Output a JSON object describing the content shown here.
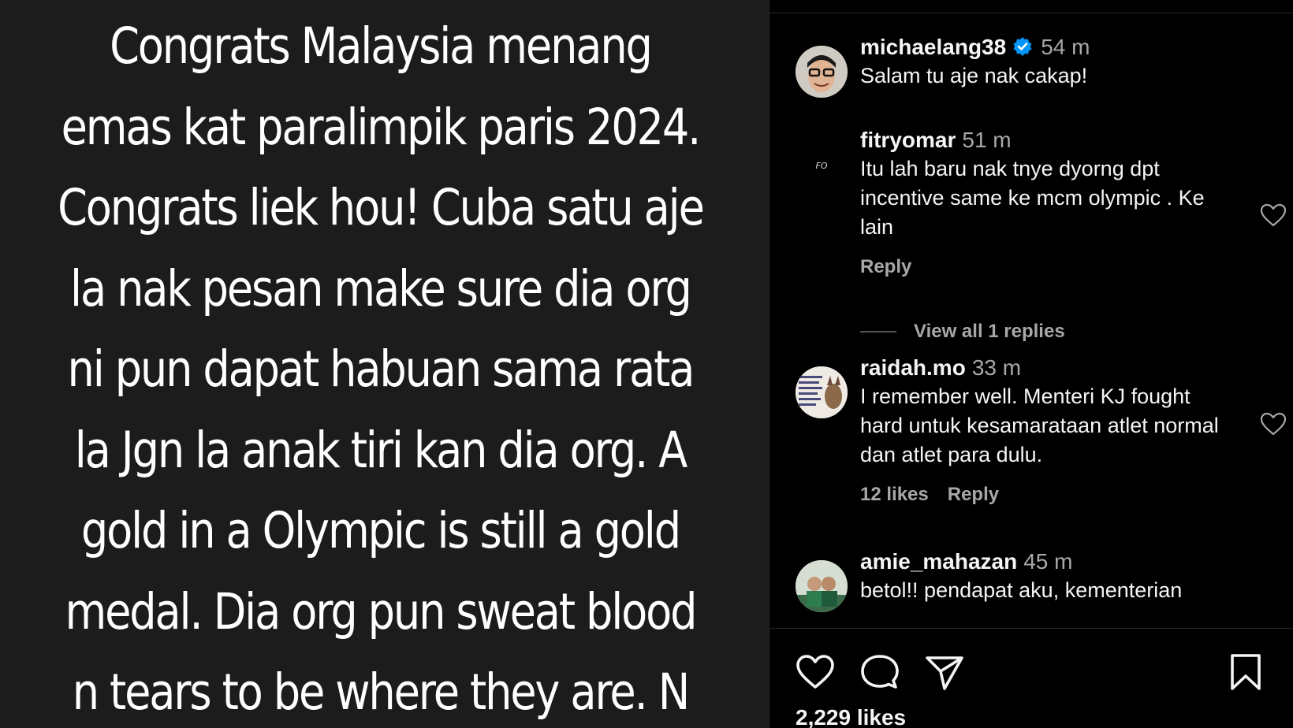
{
  "post": {
    "caption": "Congrats Malaysia menang\nemas kat paralimpik paris 2024.\nCongrats liek hou! Cuba satu aje\nla nak pesan make sure dia org\nni pun dapat habuan sama rata\nla Jgn la anak tiri kan dia org. A\ngold in a Olympic is still a gold\nmedal. Dia org pun sweat blood\nn tears to be where they are. N"
  },
  "comments": [
    {
      "username": "michaelang38",
      "verified": true,
      "time": "54 m",
      "text": "Salam tu aje nak cakap!"
    },
    {
      "username": "fitryomar",
      "time": "51 m",
      "text": "Itu lah baru nak tnye dyorng dpt incentive same ke mcm olympic . Ke lain",
      "reply_label": "Reply",
      "view_replies_label": "View all 1 replies"
    },
    {
      "username": "raidah.mo",
      "time": "33 m",
      "text": "I remember well. Menteri KJ fought hard untuk kesamarataan atlet normal dan atlet para dulu.",
      "likes_label": "12 likes",
      "reply_label": "Reply"
    },
    {
      "username": "amie_mahazan",
      "time": "45 m",
      "text": "betol!! pendapat aku, kementerian"
    }
  ],
  "footer": {
    "likes": "2,229 likes"
  },
  "icons": {
    "verified_badge": "verified-badge-icon",
    "like": "heart-icon",
    "comment": "comment-icon",
    "share": "paper-plane-icon",
    "save": "bookmark-icon"
  },
  "colors": {
    "verified": "#0095f6",
    "muted_text": "#a8a8a8",
    "panel_bg": "#000000",
    "media_bg": "#1c1c1c"
  }
}
